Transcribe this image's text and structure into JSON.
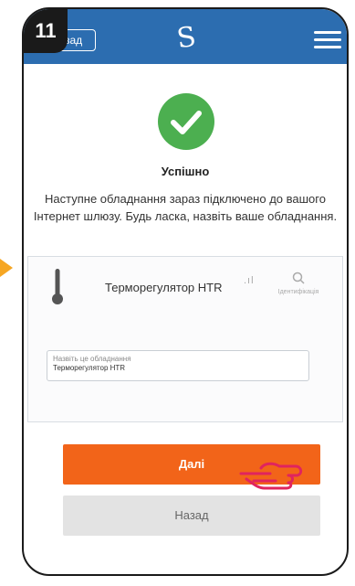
{
  "step": {
    "number": "11"
  },
  "header": {
    "back_label": "Назад",
    "logo": "S"
  },
  "status": {
    "title": "Успішно",
    "message": "Наступне обладнання зараз підключено до вашого Інтернет шлюзу. Будь ласка, назвіть ваше обладнання."
  },
  "device": {
    "name": "Терморегулятор HTR",
    "identify_label": "Ідентифікація",
    "name_field": {
      "label": "Назвіть це обладнання",
      "value": "Терморегулятор HTR"
    }
  },
  "buttons": {
    "next_label": "Далі",
    "back_label": "Назад"
  },
  "colors": {
    "header": "#2c6db0",
    "success": "#4caf50",
    "primary": "#f26419",
    "secondary": "#e3e3e3",
    "step_badge": "#1a1a1a",
    "arrow": "#f6a623"
  }
}
